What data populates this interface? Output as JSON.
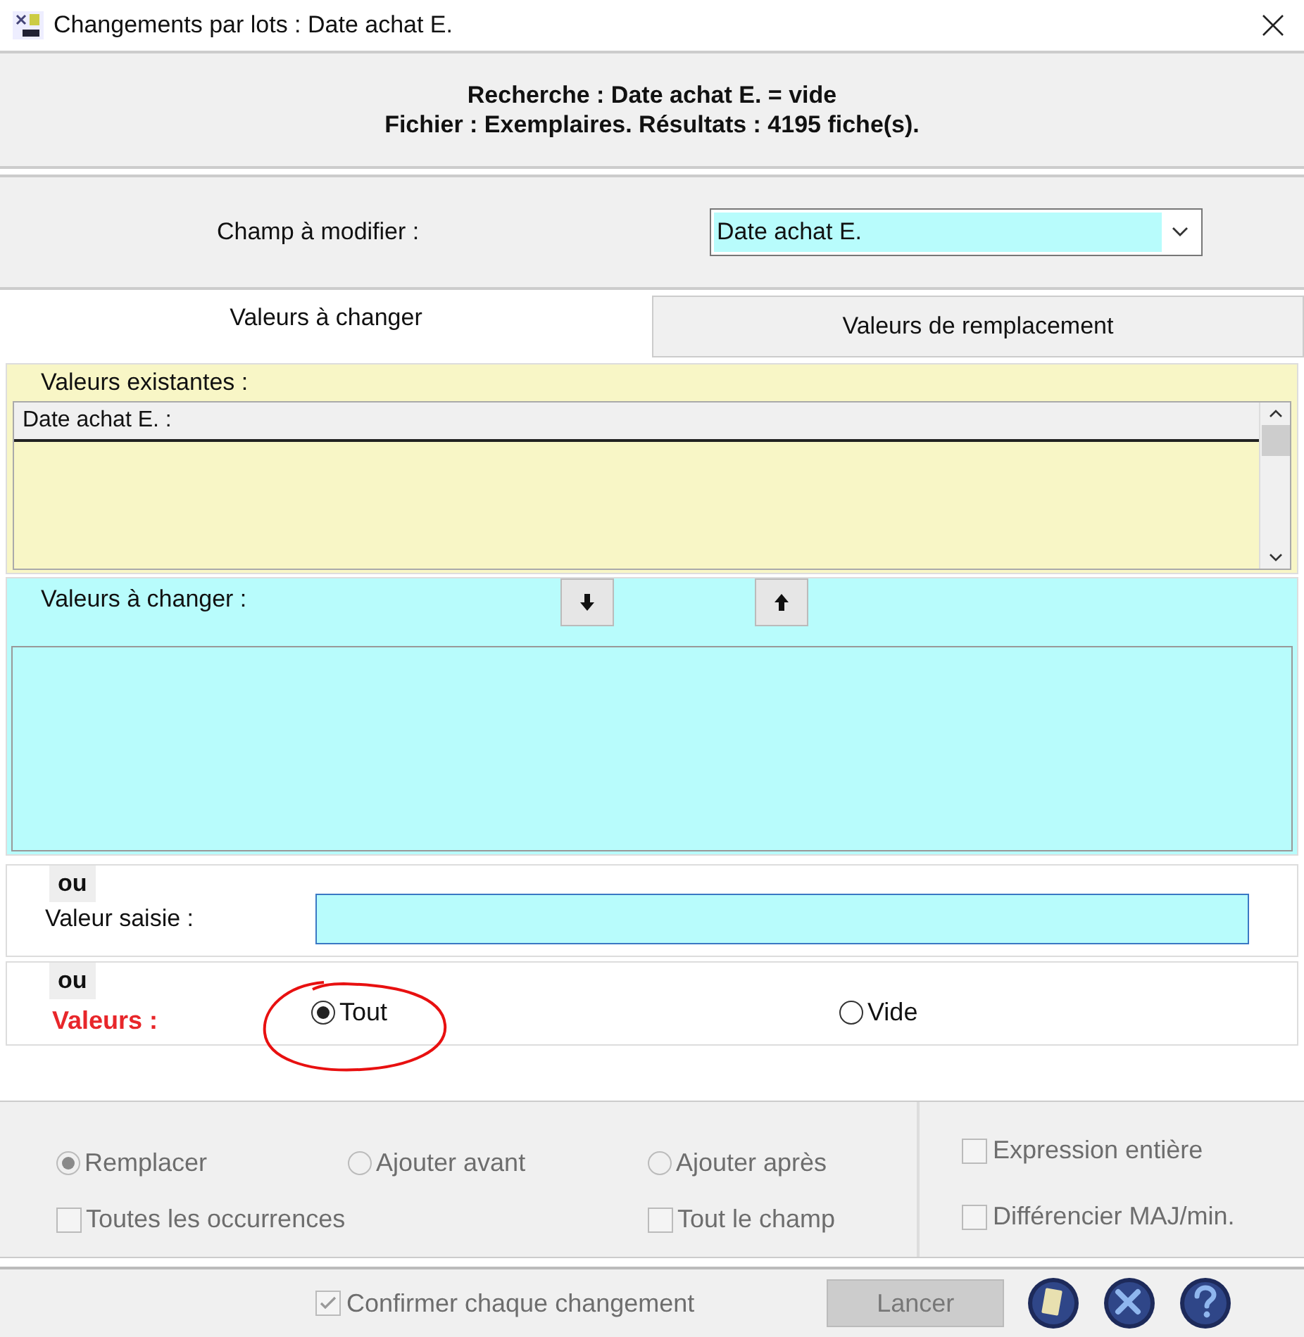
{
  "window": {
    "title": "Changements par lots : Date achat E."
  },
  "header": {
    "line_1": "Recherche : Date achat E. = vide",
    "line_2": "Fichier : Exemplaires. Résultats : 4195 fiche(s)."
  },
  "field_to_modify": {
    "label": "Champ à modifier :",
    "value": "Date achat E."
  },
  "tabs": [
    {
      "label": "Valeurs à changer",
      "selected": true
    },
    {
      "label": "Valeurs de remplacement",
      "selected": false
    }
  ],
  "existing_values": {
    "title": "Valeurs existantes :",
    "column": "Date achat E.  :"
  },
  "values_to_change": {
    "title": "Valeurs à changer :"
  },
  "typed_value": {
    "or": "ou",
    "label": "Valeur saisie :"
  },
  "values": {
    "or": "ou",
    "label": "Valeurs :",
    "options": [
      {
        "label": "Tout",
        "selected": true
      },
      {
        "label": "Vide",
        "selected": false
      }
    ]
  },
  "mode_options": [
    {
      "kind": "radio",
      "label": "Remplacer",
      "selected": true,
      "disabled": true
    },
    {
      "kind": "radio",
      "label": "Ajouter avant",
      "selected": false,
      "disabled": true
    },
    {
      "kind": "radio",
      "label": "Ajouter après",
      "selected": false,
      "disabled": true
    },
    {
      "kind": "checkbox",
      "label": "Toutes les occurrences",
      "checked": false,
      "disabled": true
    },
    {
      "kind": "checkbox",
      "label": "Tout le champ",
      "checked": false,
      "disabled": true
    }
  ],
  "match_options": [
    {
      "label": "Expression entière",
      "checked": false,
      "disabled": true
    },
    {
      "label": "Différencier MAJ/min.",
      "checked": false,
      "disabled": true
    }
  ],
  "footer": {
    "confirm": {
      "label": "Confirmer chaque changement",
      "checked": true,
      "disabled": true
    },
    "launch": {
      "label": "Lancer",
      "disabled": true
    }
  }
}
